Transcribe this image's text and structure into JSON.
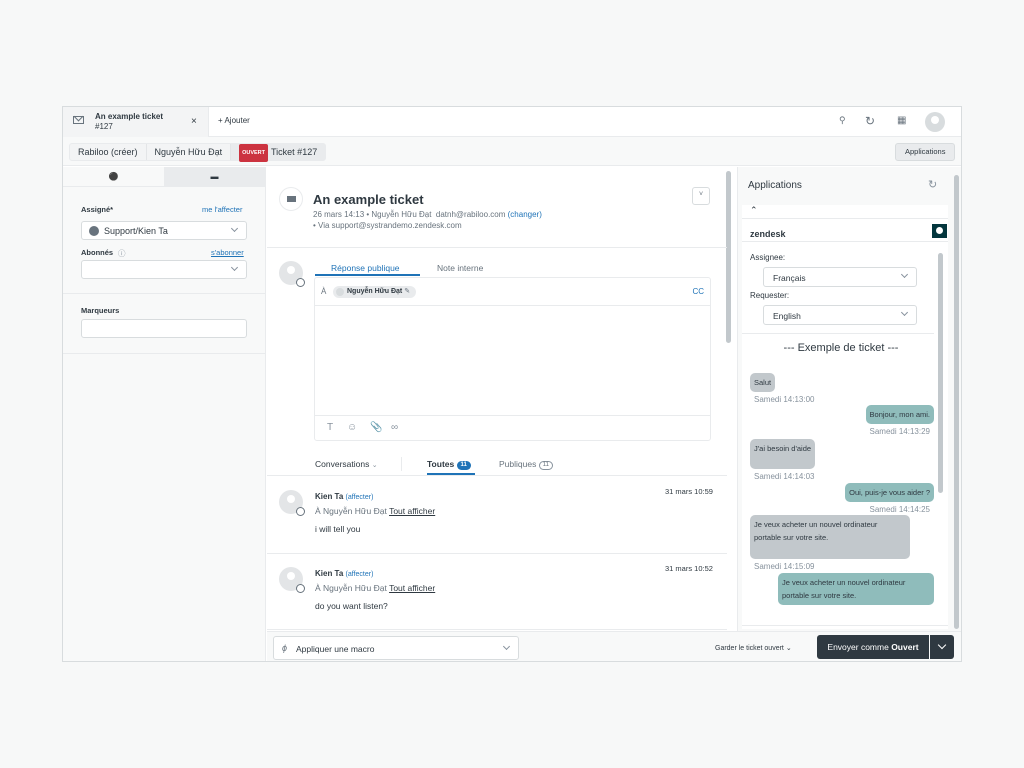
{
  "topbar": {
    "tab_title": "An example ticket",
    "tab_subtitle": "#127",
    "tab_close": "×",
    "add_label": "+ Ajouter",
    "icons": [
      "search-icon",
      "refresh-icon",
      "apps-grid-icon",
      "user-avatar"
    ]
  },
  "breadcrumb": {
    "items": [
      "Rabiloo (créer)",
      "Nguyễn Hữu Đạt"
    ],
    "status_badge": "OUVERT",
    "ticket": "Ticket #127",
    "apps_button": "Applications"
  },
  "left": {
    "tabs": [
      "user-icon",
      "card-icon"
    ],
    "assignee_label": "Assigné*",
    "assign_me": "me l'affecter",
    "assignee_value": "Support/Kien Ta",
    "followers_label": "Abonnés",
    "subscribe": "s'abonner",
    "followers_value": "",
    "tags_label": "Marqueurs",
    "tags_value": ""
  },
  "ticket": {
    "title": "An example ticket",
    "meta_date": "26 mars 14:13",
    "meta_requester": "Nguyễn Hữu Đạt",
    "meta_email": "datnh@rabiloo.com",
    "meta_change": "(changer)",
    "meta_via": "• Via support@systrandemo.zendesk.com"
  },
  "reply": {
    "tab_public": "Réponse publique",
    "tab_internal": "Note interne",
    "to_label": "À",
    "recipient": "Nguyễn Hữu Đạt",
    "cc": "CC",
    "body": ""
  },
  "conversations": {
    "filter_label": "Conversations",
    "tabs": [
      {
        "label": "Toutes",
        "count": "11",
        "selected": true
      },
      {
        "label": "Publiques",
        "count": "11",
        "selected": false
      }
    ],
    "messages": [
      {
        "author": "Kien Ta",
        "assign": "(affecter)",
        "to": "À Nguyễn Hữu Đạt",
        "show_all": "Tout afficher",
        "body": "i will tell you",
        "time": "31 mars 10:59"
      },
      {
        "author": "Kien Ta",
        "assign": "(affecter)",
        "to": "À Nguyễn Hữu Đạt",
        "show_all": "Tout afficher",
        "body": "do you want listen?",
        "time": "31 mars 10:52"
      }
    ]
  },
  "footer": {
    "macro_placeholder": "Appliquer une macro",
    "keep_status": "Garder le ticket ouvert",
    "submit_prefix": "Envoyer comme ",
    "submit_status": "Ouvert"
  },
  "apps": {
    "title": "Applications",
    "app_name": "zendesk",
    "assignee_label": "Assignee:",
    "assignee_lang": "Français",
    "requester_label": "Requester:",
    "requester_lang": "English",
    "example_title": "--- Exemple de ticket ---",
    "chat": [
      {
        "side": "in",
        "text": "Salut",
        "time": "Samedi 14:13:00"
      },
      {
        "side": "out",
        "text": "Bonjour, mon ami.",
        "time": "Samedi 14:13:29"
      },
      {
        "side": "in",
        "text": "J'ai besoin d'aide",
        "time": "Samedi 14:14:03"
      },
      {
        "side": "out",
        "text": "Oui, puis-je vous aider ?",
        "time": "Samedi 14:14:25"
      },
      {
        "side": "in",
        "text": "Je veux acheter un nouvel ordinateur portable sur votre site.",
        "time": "Samedi 14:15:09"
      },
      {
        "side": "out",
        "text": "Je veux acheter un nouvel ordinateur portable sur votre site.",
        "time": ""
      }
    ]
  },
  "colors": {
    "accent": "#1f73b7",
    "open_status": "#cc3340",
    "submit_bg": "#2f3941",
    "bubble_in": "#c2c8cc",
    "bubble_out": "#8fbcbb"
  }
}
